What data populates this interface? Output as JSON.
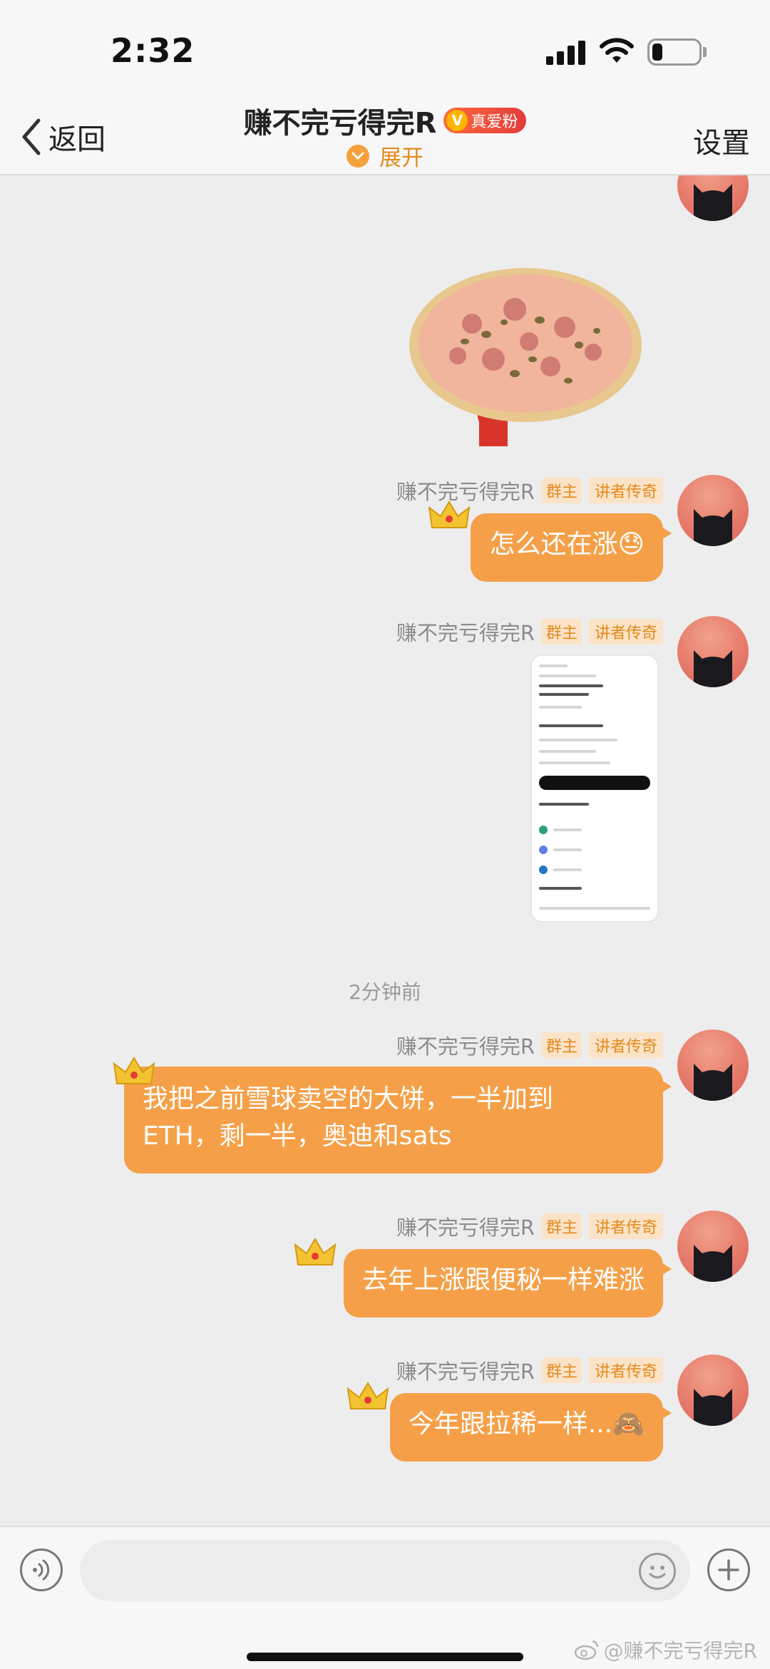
{
  "status_bar": {
    "time": "2:32"
  },
  "header": {
    "back_label": "返回",
    "title": "赚不完亏得完R",
    "fan_badge": "真爱粉",
    "expand_label": "展开",
    "settings_label": "设置"
  },
  "messages": [
    {
      "type": "sticker",
      "sticker_name": "pizza"
    },
    {
      "type": "text",
      "sender": "赚不完亏得完R",
      "role_tag": "群主",
      "title_tag": "讲者传奇",
      "text": "怎么还在涨😓"
    },
    {
      "type": "image",
      "sender": "赚不完亏得完R",
      "role_tag": "群主",
      "title_tag": "讲者传奇"
    },
    {
      "type": "text",
      "sender": "赚不完亏得完R",
      "role_tag": "群主",
      "title_tag": "讲者传奇",
      "line1": "我把之前雪球卖空的大饼，一半加到",
      "line2": "ETH，剩一半，奥迪和sats"
    },
    {
      "type": "text",
      "sender": "赚不完亏得完R",
      "role_tag": "群主",
      "title_tag": "讲者传奇",
      "text": "去年上涨跟便秘一样难涨"
    },
    {
      "type": "text",
      "sender": "赚不完亏得完R",
      "role_tag": "群主",
      "title_tag": "讲者传奇",
      "text": "今年跟拉稀一样...🙈"
    }
  ],
  "timestamp": "2分钟前",
  "input_bar": {
    "placeholder": ""
  },
  "watermark": "@赚不完亏得完R",
  "colors": {
    "bubble": "#f5a048",
    "accent": "#e38a1d",
    "background": "#ededed"
  },
  "icons": [
    "back-chevron-icon",
    "verified-icon",
    "chevron-down-icon",
    "crown-icon",
    "cat-avatar-icon",
    "voice-icon",
    "emoji-icon",
    "plus-icon",
    "weibo-icon"
  ]
}
